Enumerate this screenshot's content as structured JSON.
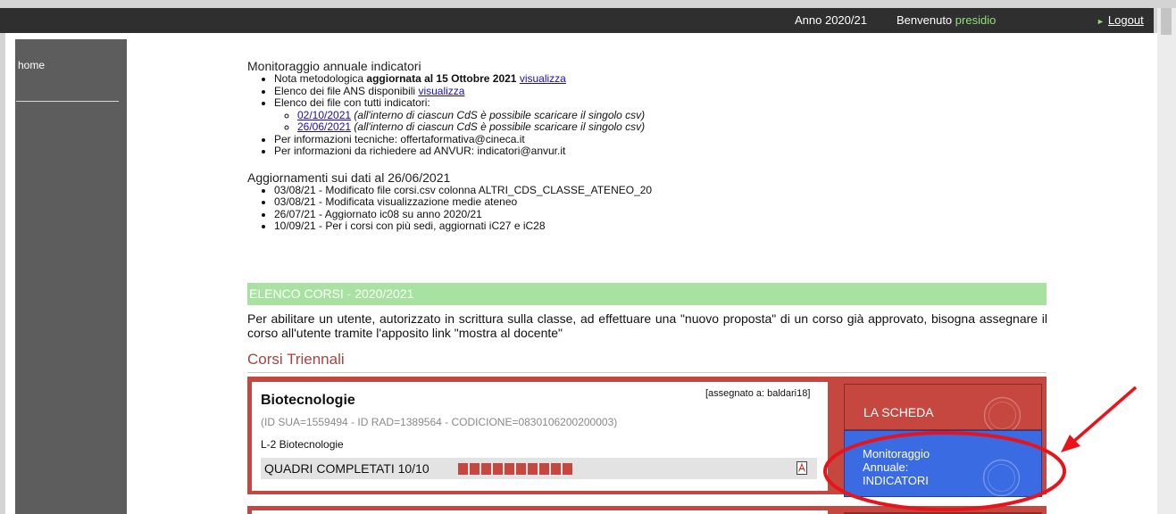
{
  "topbar": {
    "year": "Anno 2020/21",
    "welcome_prefix": "Benvenuto",
    "user": "presidio",
    "logout": "Logout"
  },
  "sidebar": {
    "home": "home"
  },
  "monitoraggio": {
    "title": "Monitoraggio annuale indicatori",
    "nota_prefix": "Nota metodologica",
    "nota_bold": "aggiornata al 15 Ottobre 2021",
    "visualizza": "visualizza",
    "elenco_ans": "Elenco dei file ANS disponibili",
    "elenco_file": "Elenco dei file con tutti indicatori:",
    "files": [
      {
        "date": "02/10/2021",
        "note": "(all'interno di ciascun CdS è possibile scaricare il singolo csv)"
      },
      {
        "date": "26/06/2021",
        "note": "(all'interno di ciascun CdS è possibile scaricare il singolo csv)"
      }
    ],
    "info_tecniche": "Per informazioni tecniche: offertaformativa@cineca.it",
    "info_anvur": "Per informazioni da richiedere ad ANVUR: indicatori@anvur.it"
  },
  "aggiornamenti": {
    "title": "Aggiornamenti sui dati al 26/06/2021",
    "items": [
      "03/08/21 - Modificato file corsi.csv colonna ALTRI_CDS_CLASSE_ATENEO_20",
      "03/08/21 - Modificata visualizzazione medie ateneo",
      "26/07/21 - Aggiornato ic08 su anno 2020/21",
      "10/09/21 - Per i corsi con più sedi, aggiornati iC27 e iC28"
    ]
  },
  "elenco": {
    "header": "ELENCO CORSI - 2020/2021",
    "abilita_text": "Per abilitare un utente, autorizzato in scrittura sulla classe, ad effettuare una \"nuovo proposta\" di un corso già approvato, bisogna assegnare il corso all'utente tramite l'apposito link \"mostra al docente\"",
    "corsi_heading": "Corsi Triennali"
  },
  "course": {
    "title": "Biotecnologie",
    "assigned": "[assegnato a: baldari18]",
    "ids": "(ID SUA=1559494 - ID RAD=1389564 - CODICIONE=0830106200200003)",
    "class": "L-2 Biotecnologie",
    "quadri": "QUADRI COMPLETATI 10/10",
    "quadri_completed": 10,
    "quadri_total": 10,
    "btn_scheda": "LA SCHEDA",
    "btn_monit_line1": "Monitoraggio Annuale:",
    "btn_monit_line2": "INDICATORI"
  },
  "icons": {
    "pdf": "pdf-icon",
    "sua_logo": "sua-logo-icon",
    "logout_arrow": "triangle-right-icon"
  },
  "colors": {
    "accent_red": "#c64640",
    "accent_blue": "#3a6be3",
    "green_bar": "#a8e2a0",
    "annotation_red": "#e8141b"
  }
}
